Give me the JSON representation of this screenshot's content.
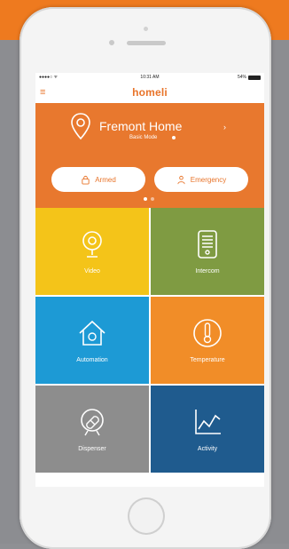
{
  "app": {
    "brand": "homeli"
  },
  "status_bar": {
    "time": "10:31 AM",
    "battery": "54%"
  },
  "header": {
    "home_name": "Fremont Home",
    "home_status": "Basic Mode"
  },
  "actions": {
    "arm_label": "Armed",
    "emergency_label": "Emergency"
  },
  "pager": {
    "count": 2,
    "active": 0
  },
  "tiles": [
    {
      "label": "Video",
      "icon": "camera-icon",
      "color": "#f4c419"
    },
    {
      "label": "Intercom",
      "icon": "intercom-icon",
      "color": "#7f9b42"
    },
    {
      "label": "Automation",
      "icon": "house-icon",
      "color": "#1d9ad5"
    },
    {
      "label": "Temperature",
      "icon": "thermometer-icon",
      "color": "#f18d28"
    },
    {
      "label": "Dispenser",
      "icon": "pill-icon",
      "color": "#8d8d8d"
    },
    {
      "label": "Activity",
      "icon": "chart-icon",
      "color": "#1f5b8e"
    }
  ],
  "colors": {
    "accent": "#e8782e",
    "page_top": "#ee7a1f",
    "page_bg": "#8c8d91"
  }
}
